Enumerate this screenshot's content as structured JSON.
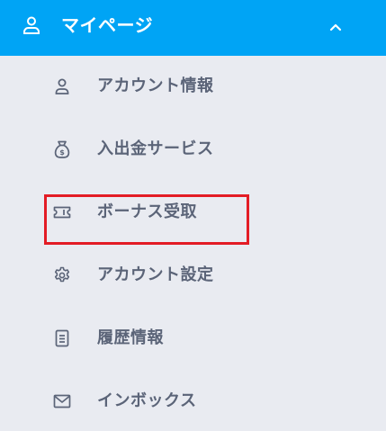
{
  "header": {
    "title": "マイページ",
    "user_icon": "user-icon",
    "chevron_icon": "chevron-up-icon",
    "background_color": "#00a4f5"
  },
  "menu": {
    "items": [
      {
        "label": "アカウント情報",
        "icon": "user-icon"
      },
      {
        "label": "入出金サービス",
        "icon": "money-bag-icon"
      },
      {
        "label": "ボーナス受取",
        "icon": "ticket-icon"
      },
      {
        "label": "アカウント設定",
        "icon": "gear-icon",
        "highlighted": true
      },
      {
        "label": "履歴情報",
        "icon": "document-icon"
      },
      {
        "label": "インボックス",
        "icon": "mail-icon"
      }
    ]
  },
  "colors": {
    "highlight_border": "#e31c25",
    "menu_background": "#e9ebf1",
    "menu_text": "#5b6478"
  }
}
